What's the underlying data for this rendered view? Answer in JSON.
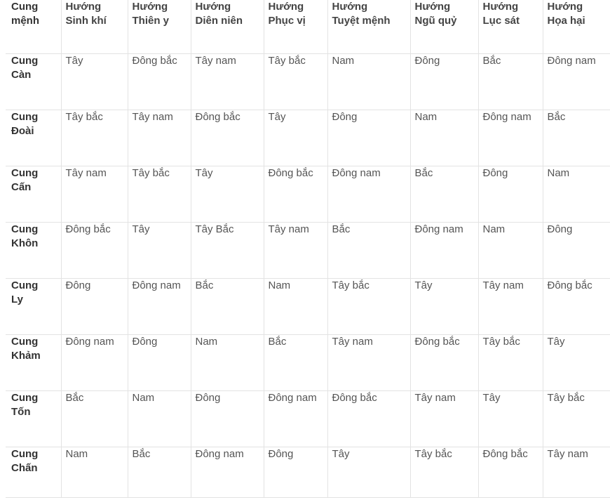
{
  "table": {
    "headers": [
      [
        "Cung",
        "mệnh"
      ],
      [
        "Hướng",
        "Sinh khí"
      ],
      [
        "Hướng",
        "Thiên y"
      ],
      [
        "Hướng",
        "Diên niên"
      ],
      [
        "Hướng",
        "Phục vị"
      ],
      [
        "Hướng",
        "Tuyệt mệnh"
      ],
      [
        "Hướng",
        "Ngũ quỷ"
      ],
      [
        "Hướng",
        "Lục sát"
      ],
      [
        "Hướng",
        "Họa hại"
      ]
    ],
    "rows": [
      {
        "cung": [
          "Cung",
          "Càn"
        ],
        "cells": [
          "Tây",
          "Đông bắc",
          "Tây nam",
          "Tây bắc",
          "Nam",
          "Đông",
          "Bắc",
          "Đông nam"
        ]
      },
      {
        "cung": [
          "Cung",
          "Đoài"
        ],
        "cells": [
          "Tây bắc",
          "Tây nam",
          "Đông bắc",
          "Tây",
          "Đông",
          "Nam",
          "Đông nam",
          "Bắc"
        ]
      },
      {
        "cung": [
          "Cung",
          "Cấn"
        ],
        "cells": [
          "Tây nam",
          "Tây bắc",
          "Tây",
          "Đông bắc",
          "Đông nam",
          "Bắc",
          "Đông",
          "Nam"
        ]
      },
      {
        "cung": [
          "Cung",
          "Khôn"
        ],
        "cells": [
          "Đông bắc",
          "Tây",
          "Tây Bắc",
          "Tây nam",
          "Bắc",
          "Đông nam",
          "Nam",
          "Đông"
        ]
      },
      {
        "cung": [
          "Cung",
          "Ly"
        ],
        "cells": [
          "Đông",
          "Đông nam",
          "Bắc",
          "Nam",
          "Tây bắc",
          "Tây",
          "Tây nam",
          "Đông bắc"
        ]
      },
      {
        "cung": [
          "Cung",
          "Khảm"
        ],
        "cells": [
          "Đông nam",
          "Đông",
          "Nam",
          "Bắc",
          "Tây nam",
          "Đông bắc",
          "Tây bắc",
          "Tây"
        ]
      },
      {
        "cung": [
          "Cung",
          "Tốn"
        ],
        "cells": [
          "Bắc",
          "Nam",
          "Đông",
          "Đông nam",
          "Đông bắc",
          "Tây nam",
          "Tây",
          "Tây bắc"
        ]
      },
      {
        "cung": [
          "Cung",
          "Chấn"
        ],
        "cells": [
          "Nam",
          "Bắc",
          "Đông nam",
          "Đông",
          "Tây",
          "Tây bắc",
          "Đông bắc",
          "Tây nam"
        ]
      }
    ]
  }
}
